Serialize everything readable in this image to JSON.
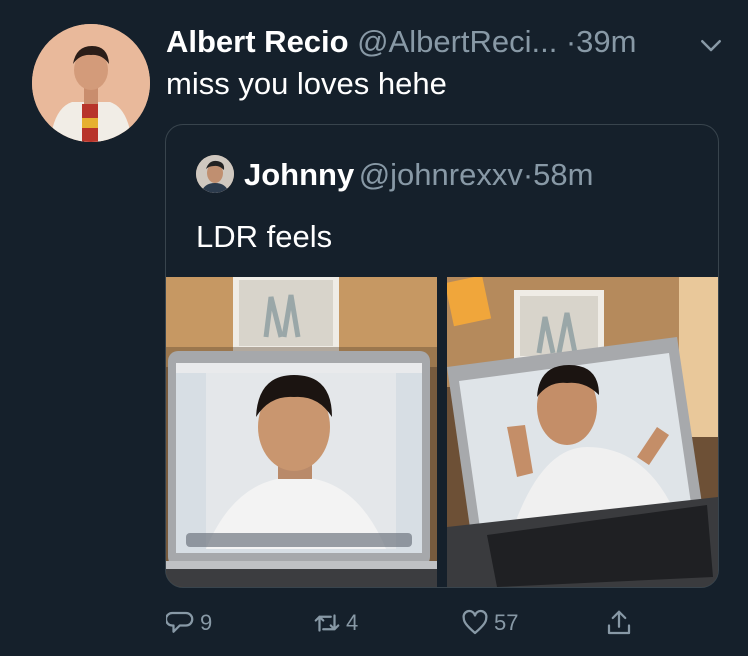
{
  "tweet": {
    "author_name": "Albert Recio",
    "author_handle": "@AlbertReci...",
    "separator": "·",
    "time": "39m",
    "text": "miss you loves hehe",
    "avatar_icon": "user-avatar",
    "more_icon": "chevron-down-icon"
  },
  "quote": {
    "author_name": "Johnny",
    "author_handle": "@johnrexxv",
    "separator": "·",
    "time": "58m",
    "text": "LDR feels"
  },
  "actions": {
    "reply_count": "9",
    "retweet_count": "4",
    "like_count": "57",
    "icons": [
      "reply-icon",
      "retweet-icon",
      "like-icon",
      "share-icon"
    ]
  },
  "colors": {
    "background": "#15202b",
    "border": "#38444d",
    "muted_text": "#8899a6",
    "primary_text": "#ffffff"
  }
}
